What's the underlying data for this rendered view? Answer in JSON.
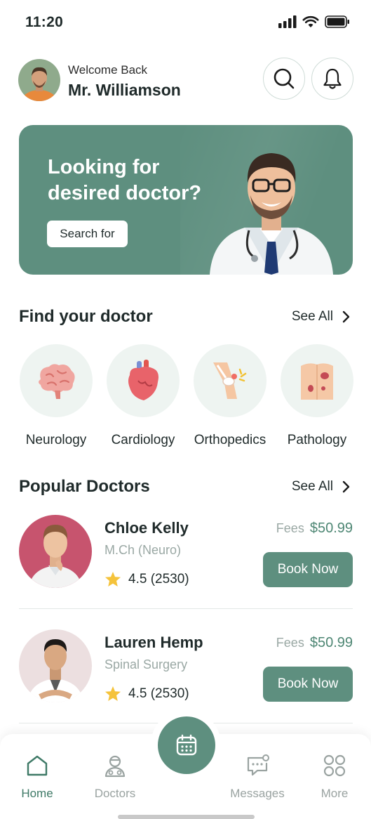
{
  "status_bar": {
    "time": "11:20",
    "icons": [
      "signal-icon",
      "wifi-icon",
      "battery-icon"
    ]
  },
  "header": {
    "welcome": "Welcome Back",
    "user_name": "Mr. Williamson",
    "icons": [
      "search-icon",
      "bell-icon"
    ]
  },
  "banner": {
    "title_line1": "Looking for",
    "title_line2": "desired doctor?",
    "button_label": "Search for"
  },
  "find_doctor": {
    "title": "Find your doctor",
    "see_all": "See All",
    "specialties": [
      {
        "label": "Neurology",
        "icon": "brain-icon"
      },
      {
        "label": "Cardiology",
        "icon": "heart-icon"
      },
      {
        "label": "Orthopedics",
        "icon": "bone-joint-icon"
      },
      {
        "label": "Pathology",
        "icon": "body-icon"
      }
    ]
  },
  "popular": {
    "title": "Popular Doctors",
    "see_all": "See All",
    "fees_label": "Fees",
    "book_label": "Book Now",
    "doctors": [
      {
        "name": "Chloe Kelly",
        "specialty": "M.Ch (Neuro)",
        "rating": "4.5 (2530)",
        "fee": "$50.99"
      },
      {
        "name": "Lauren Hemp",
        "specialty": "Spinal Surgery",
        "rating": "4.5 (2530)",
        "fee": "$50.99"
      }
    ]
  },
  "tabbar": {
    "tabs": [
      {
        "label": "Home",
        "icon": "home-icon",
        "active": true
      },
      {
        "label": "Doctors",
        "icon": "doctor-icon",
        "active": false
      },
      {
        "label": "Messages",
        "icon": "message-icon",
        "active": false
      },
      {
        "label": "More",
        "icon": "grid-icon",
        "active": false
      }
    ],
    "center_icon": "calendar-icon"
  },
  "colors": {
    "primary": "#5e8f7f",
    "accent_text": "#4d8673",
    "muted": "#9aa8a4",
    "circle_bg": "#eef4f1"
  }
}
